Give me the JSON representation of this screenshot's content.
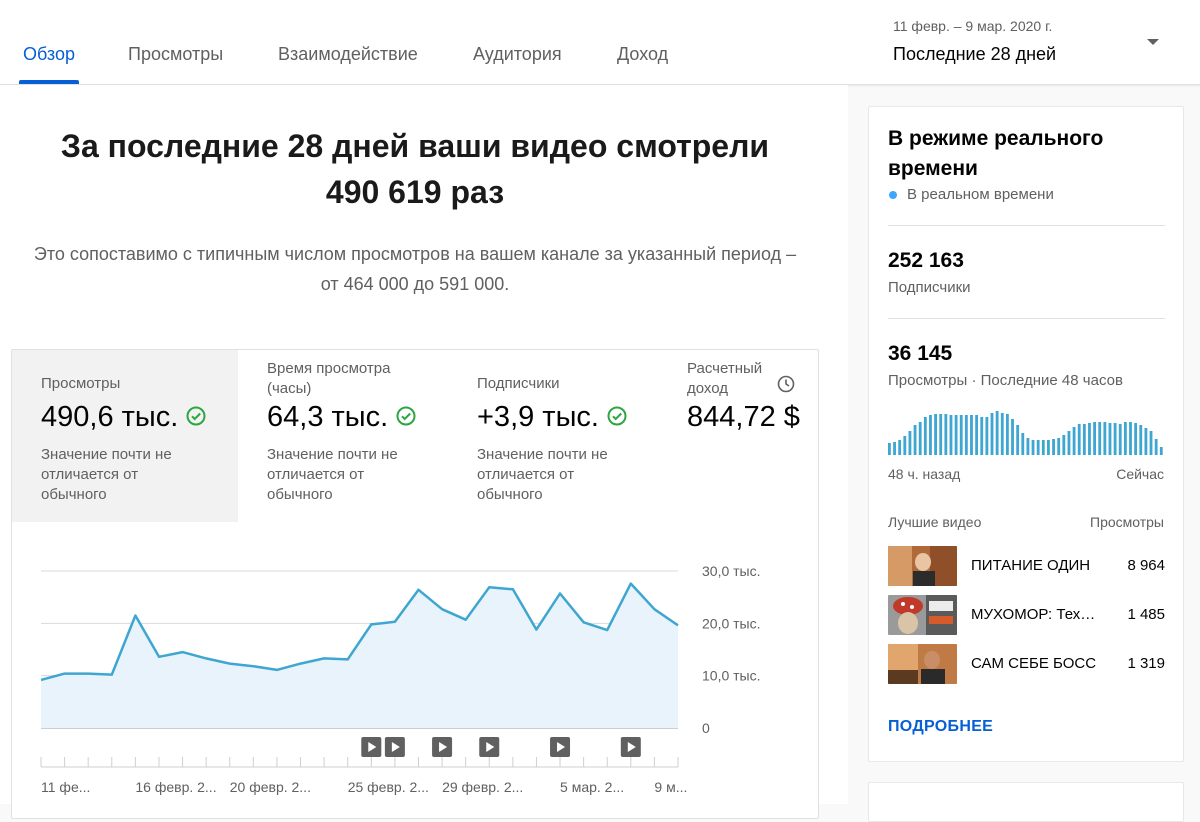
{
  "tabs": [
    {
      "label": "Обзор",
      "active": true
    },
    {
      "label": "Просмотры",
      "active": false
    },
    {
      "label": "Взаимодействие",
      "active": false
    },
    {
      "label": "Аудитория",
      "active": false
    },
    {
      "label": "Доход",
      "active": false
    }
  ],
  "date_selector": {
    "range": "11 февр. – 9 мар. 2020 г.",
    "label": "Последние 28 дней"
  },
  "headline": {
    "line1": "За последние 28 дней ваши видео смотрели",
    "line2": "490 619 раз"
  },
  "subline": {
    "line1": "Это сопоставимо с типичным числом просмотров на вашем канале за указанный период –",
    "line2": "от 464 000 до 591 000."
  },
  "metrics": [
    {
      "label1": "Просмотры",
      "label2": "",
      "value": "490,6 тыс.",
      "note1": "Значение почти не",
      "note2": "отличается от",
      "note3": "обычного",
      "check": true
    },
    {
      "label1": "Время просмотра",
      "label2": "(часы)",
      "value": "64,3 тыс.",
      "note1": "Значение почти не",
      "note2": "отличается от",
      "note3": "обычного",
      "check": true
    },
    {
      "label1": "Подписчики",
      "label2": "",
      "value": "+3,9 тыс.",
      "note1": "Значение почти не",
      "note2": "отличается от",
      "note3": "обычного",
      "check": true
    },
    {
      "label1": "Расчетный",
      "label2": "доход",
      "value": "844,72 $",
      "note1": "",
      "note2": "",
      "note3": "",
      "check": false
    }
  ],
  "colors": {
    "accent": "#065fd4",
    "line": "#3ea6d0",
    "area": "#e8f3fb",
    "check": "#2ba640",
    "realtime": "#3ea6ff"
  },
  "chart_data": {
    "type": "area",
    "x": [
      1,
      2,
      3,
      4,
      5,
      6,
      7,
      8,
      9,
      10,
      11,
      12,
      13,
      14,
      15,
      16,
      17,
      18,
      19,
      20,
      21,
      22,
      23,
      24,
      25,
      26,
      27,
      28
    ],
    "x_tick_labels": [
      "11 фе...",
      "16 февр. 2...",
      "20 февр. 2...",
      "25 февр. 2...",
      "29 февр. 2...",
      "5 мар. 2...",
      "9 м..."
    ],
    "x_tick_positions": [
      1,
      5,
      9,
      14,
      18,
      23,
      27
    ],
    "values": [
      9200,
      10400,
      10400,
      10200,
      21500,
      13600,
      14500,
      13300,
      12300,
      11800,
      11100,
      12300,
      13300,
      13100,
      19800,
      20300,
      26400,
      22700,
      20700,
      26900,
      26500,
      18800,
      25700,
      20200,
      18700,
      27600,
      22700,
      19600
    ],
    "y_ticks": [
      "30,0 тыс.",
      "20,0 тыс.",
      "10,0 тыс.",
      "0"
    ],
    "y_tick_values": [
      30000,
      20000,
      10000,
      0
    ],
    "ylim": [
      0,
      30000
    ],
    "video_markers": [
      15,
      16,
      18,
      20,
      23,
      26
    ],
    "grid": true
  },
  "realtime": {
    "title": "В режиме реального времени",
    "status": "В реальном времени",
    "subscribers_value": "252 163",
    "subscribers_label": "Подписчики",
    "views_value": "36 145",
    "views_label": "Просмотры · Последние 48 часов",
    "axis_left": "48 ч. назад",
    "axis_right": "Сейчас",
    "bars": [
      12,
      13,
      15,
      19,
      24,
      30,
      33,
      38,
      40,
      41,
      41,
      41,
      40,
      40,
      40,
      40,
      40,
      40,
      38,
      38,
      42,
      44,
      42,
      41,
      36,
      30,
      22,
      17,
      15,
      15,
      15,
      15,
      16,
      17,
      20,
      24,
      28,
      31,
      31,
      32,
      33,
      33,
      33,
      32,
      32,
      31,
      33,
      33,
      32,
      30,
      27,
      24,
      16,
      8
    ],
    "top_videos_header": "Лучшие видео",
    "top_videos_views_header": "Просмотры",
    "videos": [
      {
        "title": "ПИТАНИЕ ОДИН",
        "views": "8 964"
      },
      {
        "title": "МУХОМОР: Техника",
        "views": "1 485"
      },
      {
        "title": "САМ СЕБЕ БОСС",
        "views": "1 319"
      }
    ],
    "more": "ПОДРОБНЕЕ"
  }
}
